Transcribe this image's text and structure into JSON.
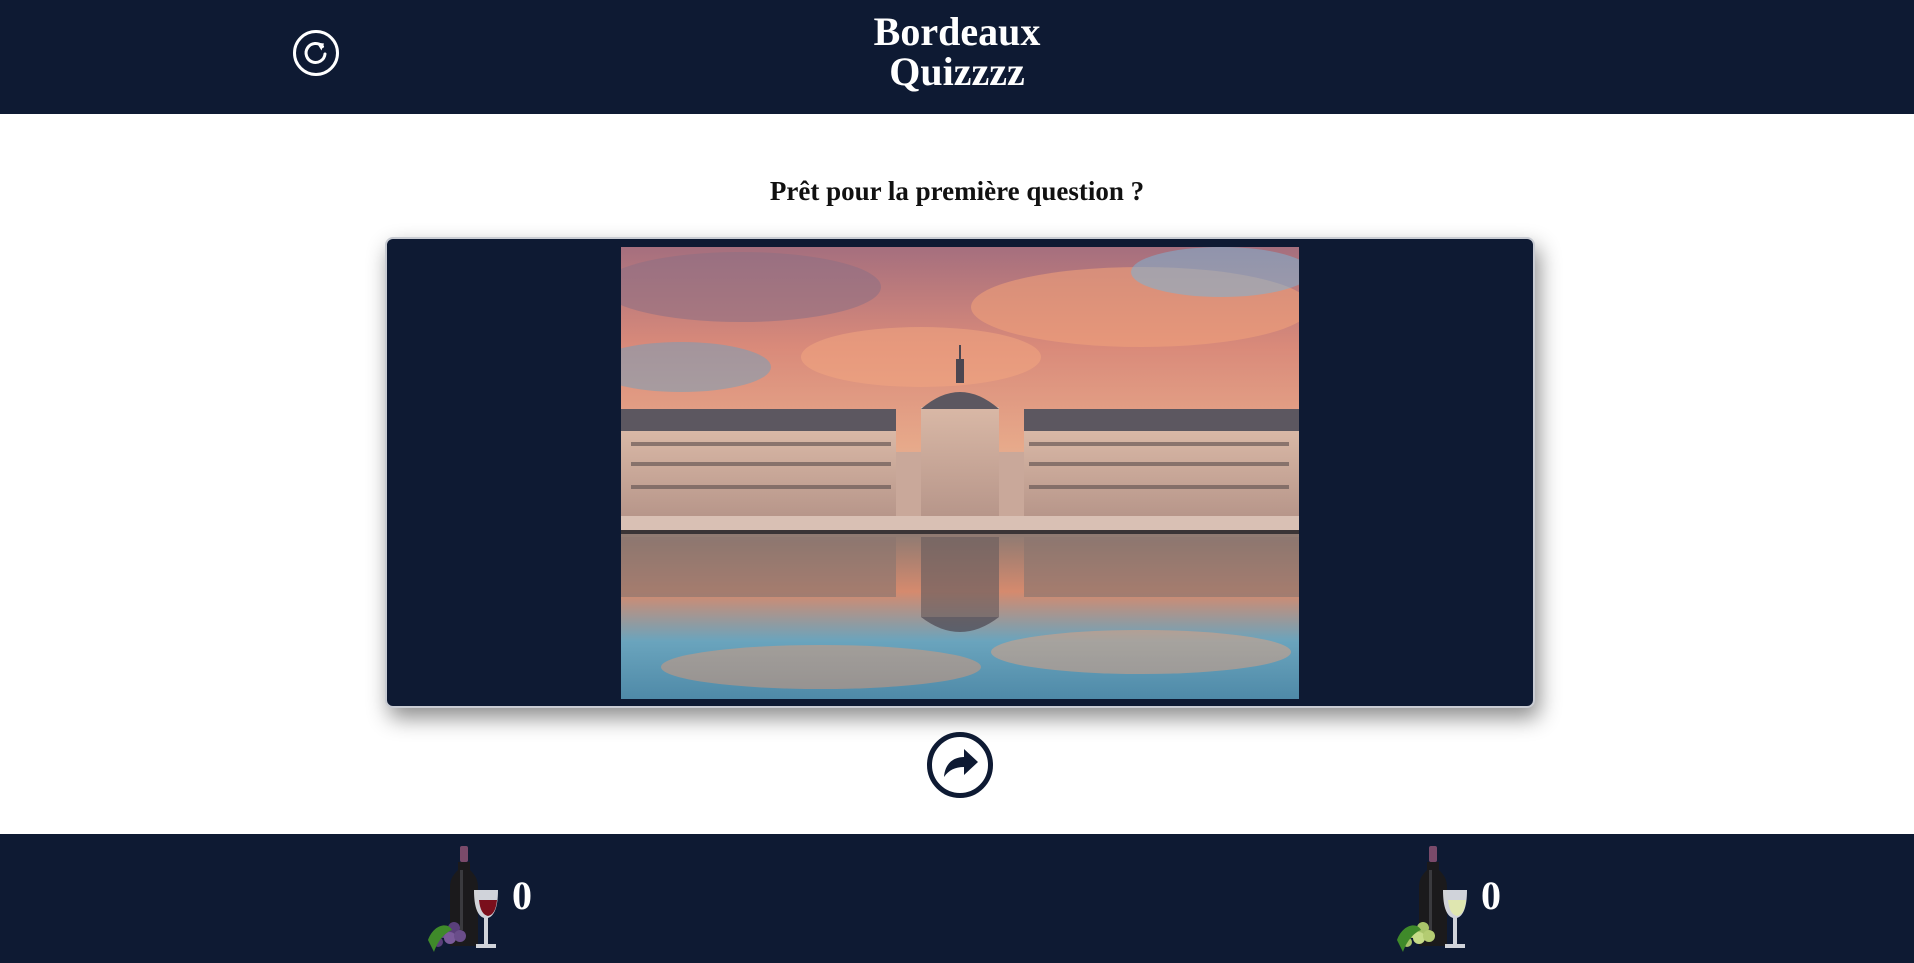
{
  "header": {
    "title_line1": "Bordeaux",
    "title_line2": "Quizzzz",
    "refresh_icon": "refresh-icon"
  },
  "main": {
    "prompt": "Prêt pour la première question ?",
    "next_icon": "share-arrow-icon"
  },
  "footer": {
    "red_score": "0",
    "white_score": "0",
    "red_icon": "red-wine-icon",
    "white_icon": "white-wine-icon"
  },
  "colors": {
    "navy": "#0e1a33",
    "white": "#ffffff",
    "red_wine": "#7a0f1c",
    "white_wine": "#dfe6b0"
  }
}
